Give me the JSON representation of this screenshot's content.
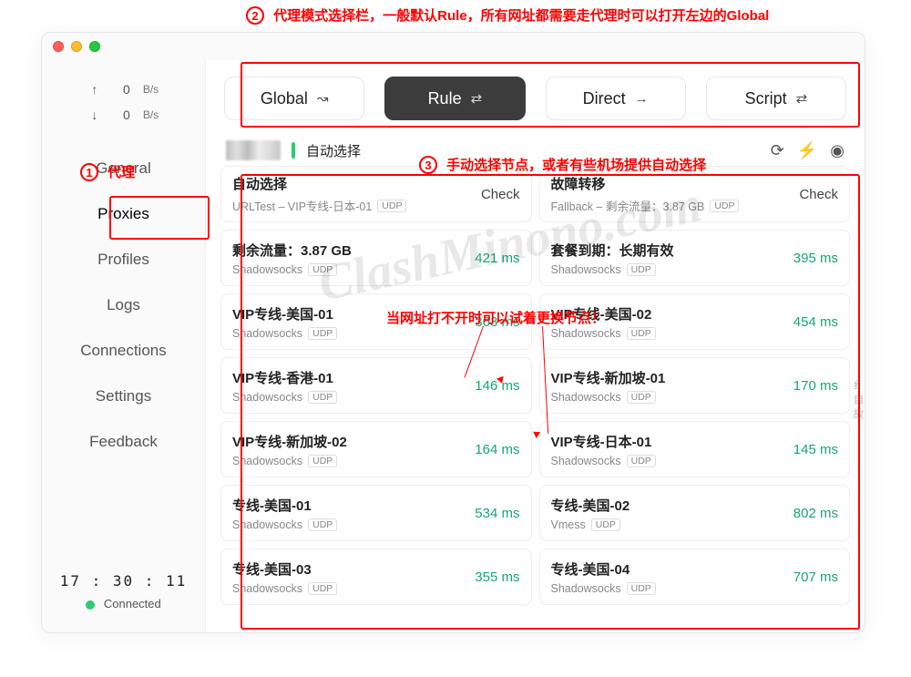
{
  "annotations": {
    "one_label": "代理",
    "two_label": "代理模式选择栏，一般默认Rule，所有网址都需要走代理时可以打开左边的Global",
    "three_label": "手动选择节点，或者有些机场提供自动选择",
    "mid_hint": "当网址打不开时可以试着更换节点！"
  },
  "speeds": {
    "up": "0",
    "down": "0",
    "unit": "B/s"
  },
  "sidebar": {
    "items": [
      "General",
      "Proxies",
      "Profiles",
      "Logs",
      "Connections",
      "Settings",
      "Feedback"
    ],
    "active_index": 1,
    "time": "17 : 30 : 11",
    "status": "Connected"
  },
  "modes": {
    "items": [
      {
        "label": "Global",
        "glyph": "↝"
      },
      {
        "label": "Rule",
        "glyph": "⇄"
      },
      {
        "label": "Direct",
        "glyph": "→"
      },
      {
        "label": "Script",
        "glyph": "⇄"
      }
    ],
    "selected_index": 1
  },
  "group": {
    "selected": "自动选择"
  },
  "proxies": [
    {
      "name": "自动选择",
      "sub": "URLTest – VIP专线-日本-01",
      "udp": true,
      "latency": "Check",
      "check": true
    },
    {
      "name": "故障转移",
      "sub": "Fallback – 剩余流量：3.87 GB",
      "udp": true,
      "latency": "Check",
      "check": true
    },
    {
      "name": "剩余流量：3.87 GB",
      "sub": "Shadowsocks",
      "udp": true,
      "latency": "421 ms"
    },
    {
      "name": "套餐到期：长期有效",
      "sub": "Shadowsocks",
      "udp": true,
      "latency": "395 ms"
    },
    {
      "name": "VIP专线-美国-01",
      "sub": "Shadowsocks",
      "udp": true,
      "latency": "363 ms"
    },
    {
      "name": "VIP专线-美国-02",
      "sub": "Shadowsocks",
      "udp": true,
      "latency": "454 ms"
    },
    {
      "name": "VIP专线-香港-01",
      "sub": "Shadowsocks",
      "udp": true,
      "latency": "146 ms"
    },
    {
      "name": "VIP专线-新加坡-01",
      "sub": "Shadowsocks",
      "udp": true,
      "latency": "170 ms"
    },
    {
      "name": "VIP专线-新加坡-02",
      "sub": "Shadowsocks",
      "udp": true,
      "latency": "164 ms"
    },
    {
      "name": "VIP专线-日本-01",
      "sub": "Shadowsocks",
      "udp": true,
      "latency": "145 ms"
    },
    {
      "name": "专线-美国-01",
      "sub": "Shadowsocks",
      "udp": true,
      "latency": "534 ms"
    },
    {
      "name": "专线-美国-02",
      "sub": "Vmess",
      "udp": true,
      "latency": "802 ms"
    },
    {
      "name": "专线-美国-03",
      "sub": "Shadowsocks",
      "udp": true,
      "latency": "355 ms"
    },
    {
      "name": "专线-美国-04",
      "sub": "Shadowsocks",
      "udp": true,
      "latency": "707 ms"
    }
  ],
  "udp_label": "UDP",
  "edge_text": "纟自故",
  "watermark": "ClashMinono.com"
}
